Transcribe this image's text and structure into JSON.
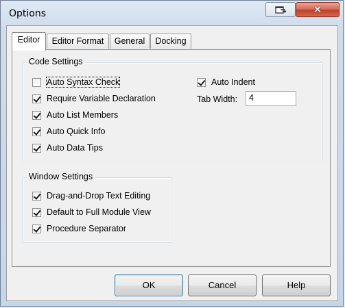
{
  "window": {
    "title": "Options"
  },
  "tabs": [
    {
      "label": "Editor",
      "active": true
    },
    {
      "label": "Editor Format",
      "active": false
    },
    {
      "label": "General",
      "active": false
    },
    {
      "label": "Docking",
      "active": false
    }
  ],
  "code_settings": {
    "legend": "Code Settings",
    "checkboxes": [
      {
        "label": "Auto Syntax Check",
        "checked": false,
        "focused": true
      },
      {
        "label": "Require Variable Declaration",
        "checked": true
      },
      {
        "label": "Auto List Members",
        "checked": true
      },
      {
        "label": "Auto Quick Info",
        "checked": true
      },
      {
        "label": "Auto Data Tips",
        "checked": true
      }
    ],
    "auto_indent": {
      "label": "Auto Indent",
      "checked": true
    },
    "tab_width": {
      "label": "Tab Width:",
      "value": "4"
    }
  },
  "window_settings": {
    "legend": "Window Settings",
    "checkboxes": [
      {
        "label": "Drag-and-Drop Text Editing",
        "checked": true
      },
      {
        "label": "Default to Full Module View",
        "checked": true
      },
      {
        "label": "Procedure Separator",
        "checked": true
      }
    ]
  },
  "buttons": {
    "ok": "OK",
    "cancel": "Cancel",
    "help": "Help"
  },
  "icons": {
    "restore": "restore-window-icon",
    "close": "close-icon"
  }
}
